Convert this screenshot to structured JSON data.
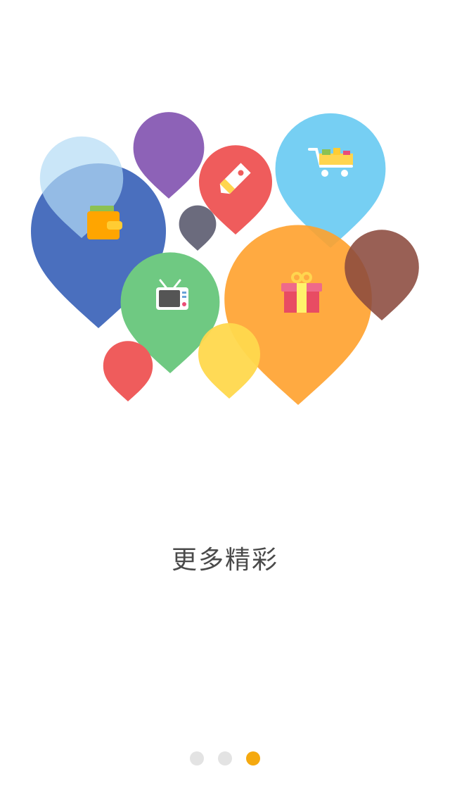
{
  "title": "更多精彩",
  "pager": {
    "count": 3,
    "active_index": 2,
    "inactive_color": "#e3e3e3",
    "active_color": "#f5a90f"
  },
  "balloon_icons": [
    "wallet-icon",
    "price-tag-icon",
    "shopping-cart-icon",
    "tv-icon",
    "gift-icon"
  ]
}
